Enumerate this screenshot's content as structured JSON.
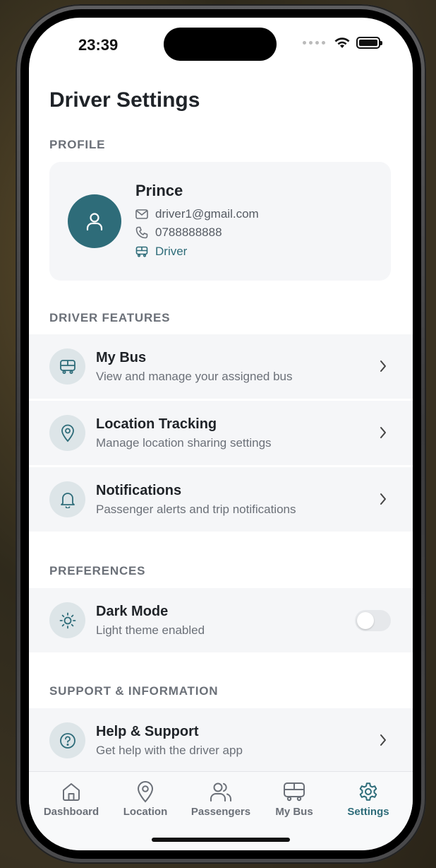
{
  "status": {
    "time": "23:39"
  },
  "page": {
    "title": "Driver Settings"
  },
  "sections": {
    "profile": "PROFILE",
    "driver_features": "DRIVER FEATURES",
    "preferences": "PREFERENCES",
    "support": "SUPPORT & INFORMATION"
  },
  "profile": {
    "name": "Prince",
    "email": "driver1@gmail.com",
    "phone": "0788888888",
    "role": "Driver"
  },
  "driver_features": [
    {
      "title": "My Bus",
      "subtitle": "View and manage your assigned bus",
      "icon": "bus-icon"
    },
    {
      "title": "Location Tracking",
      "subtitle": "Manage location sharing settings",
      "icon": "location-pin-icon"
    },
    {
      "title": "Notifications",
      "subtitle": "Passenger alerts and trip notifications",
      "icon": "bell-icon"
    }
  ],
  "preferences": [
    {
      "title": "Dark Mode",
      "subtitle": "Light theme enabled",
      "icon": "sun-icon",
      "toggle_on": false
    }
  ],
  "support": [
    {
      "title": "Help & Support",
      "subtitle": "Get help with the driver app",
      "icon": "help-icon"
    }
  ],
  "tabs": [
    {
      "label": "Dashboard",
      "icon": "home-icon",
      "active": false
    },
    {
      "label": "Location",
      "icon": "location-pin-icon",
      "active": false
    },
    {
      "label": "Passengers",
      "icon": "users-icon",
      "active": false
    },
    {
      "label": "My Bus",
      "icon": "bus-icon",
      "active": false
    },
    {
      "label": "Settings",
      "icon": "gear-icon",
      "active": true
    }
  ],
  "colors": {
    "accent": "#2e6c79",
    "row_background": "#f5f6f8",
    "icon_circle": "#dde5e8",
    "text_primary": "#1f2328",
    "text_secondary": "#6b7078"
  }
}
